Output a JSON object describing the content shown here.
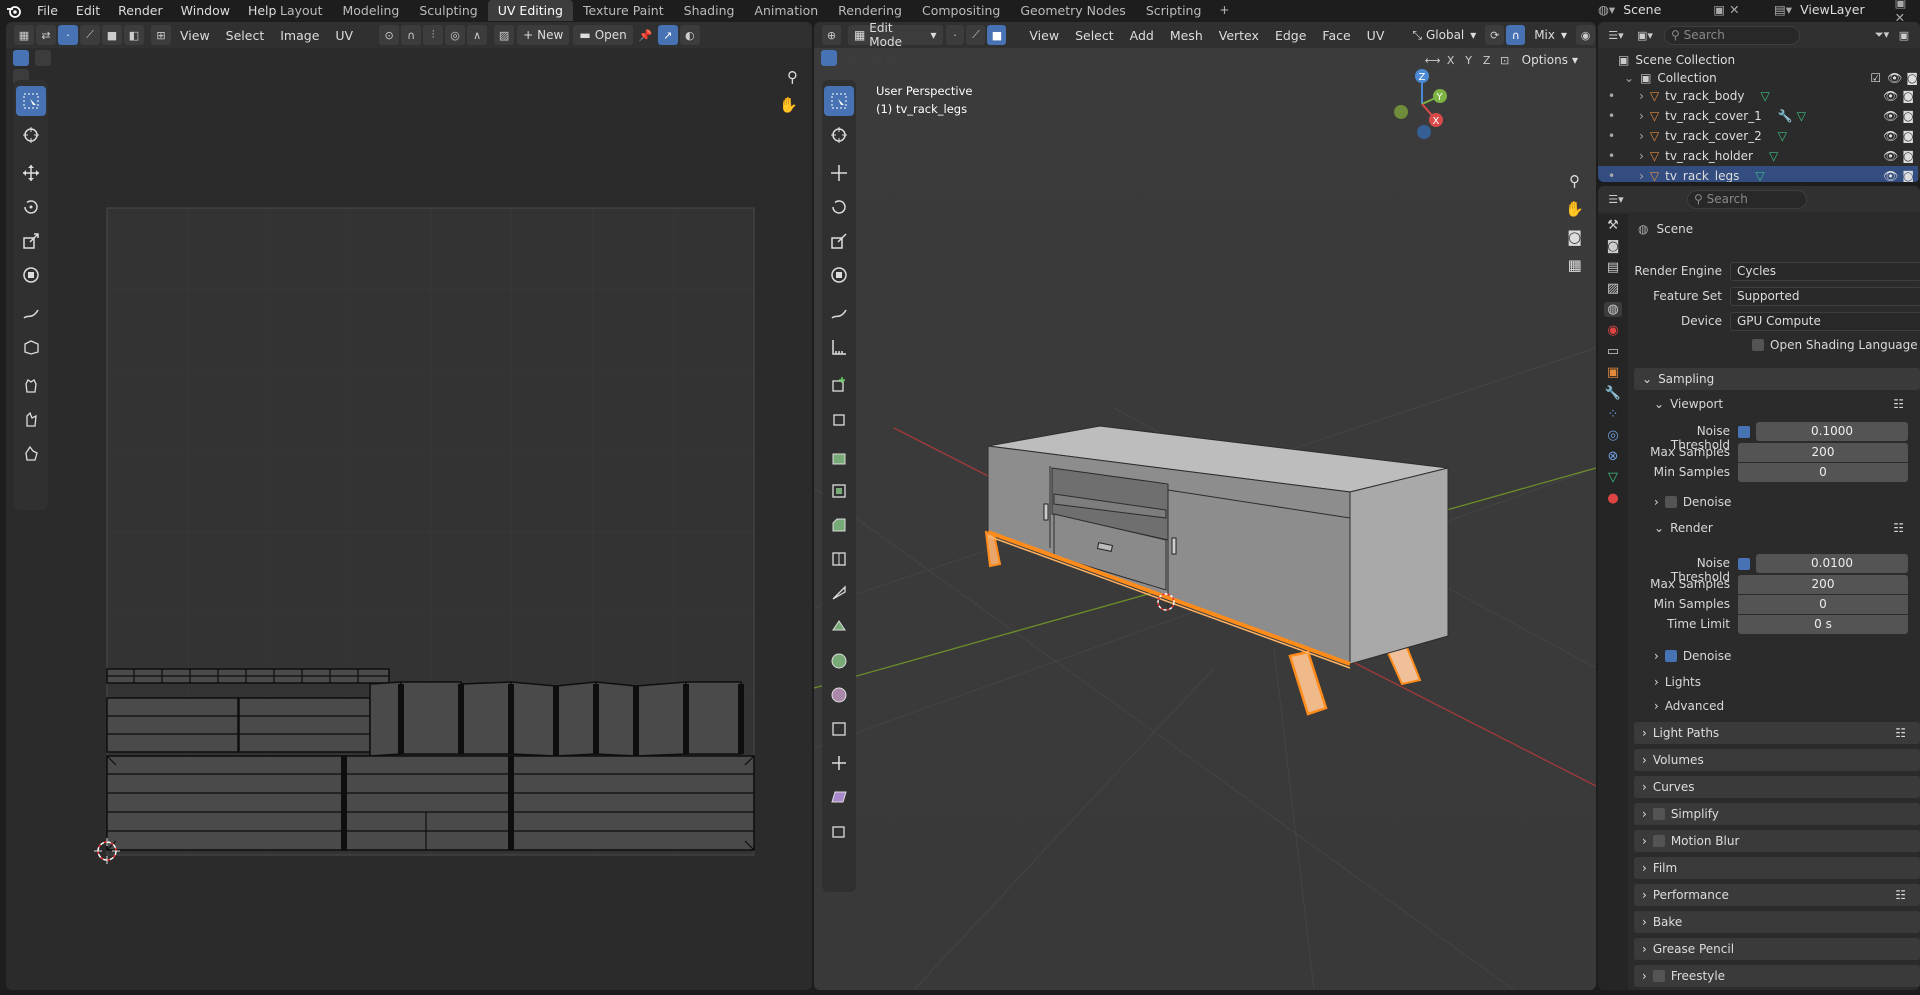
{
  "menu": [
    "File",
    "Edit",
    "Render",
    "Window",
    "Help"
  ],
  "workspaces": [
    "Layout",
    "Modeling",
    "Sculpting",
    "UV Editing",
    "Texture Paint",
    "Shading",
    "Animation",
    "Rendering",
    "Compositing",
    "Geometry Nodes",
    "Scripting"
  ],
  "active_workspace": "UV Editing",
  "scene_name": "Scene",
  "view_layer": "ViewLayer",
  "uv_editor": {
    "menus": [
      "View",
      "Select",
      "Image",
      "UV"
    ],
    "new_label": "New",
    "open_label": "Open"
  },
  "viewport": {
    "mode": "Edit Mode",
    "menus": [
      "View",
      "Select",
      "Add",
      "Mesh",
      "Vertex",
      "Edge",
      "Face",
      "UV"
    ],
    "orientation": "Global",
    "shading": "Mix",
    "options_label": "Options",
    "axes": [
      "X",
      "Y",
      "Z"
    ],
    "overlay_title": "User Perspective",
    "overlay_object": "(1) tv_rack_legs"
  },
  "outliner": {
    "search_placeholder": "Search",
    "scene_collection": "Scene Collection",
    "collection": "Collection",
    "objects": [
      "tv_rack_body",
      "tv_rack_cover_1",
      "tv_rack_cover_2",
      "tv_rack_holder",
      "tv_rack_legs"
    ]
  },
  "properties": {
    "search_placeholder": "Search",
    "context": "Scene",
    "render_engine_label": "Render Engine",
    "render_engine": "Cycles",
    "feature_set_label": "Feature Set",
    "feature_set": "Supported",
    "device_label": "Device",
    "device": "GPU Compute",
    "osl_label": "Open Shading Language",
    "sampling": "Sampling",
    "viewport_label": "Viewport",
    "noise_threshold_label": "Noise Threshold",
    "viewport_noise": "0.1000",
    "max_samples_label": "Max Samples",
    "viewport_max": "200",
    "min_samples_label": "Min Samples",
    "viewport_min": "0",
    "denoise_label": "Denoise",
    "render_label": "Render",
    "render_noise": "0.0100",
    "render_max": "200",
    "render_min": "0",
    "time_limit_label": "Time Limit",
    "time_limit": "0 s",
    "lights": "Lights",
    "advanced": "Advanced",
    "panels": [
      "Light Paths",
      "Volumes",
      "Curves",
      "Simplify",
      "Motion Blur",
      "Film",
      "Performance",
      "Bake",
      "Grease Pencil",
      "Freestyle"
    ]
  },
  "colors": {
    "accent": "#4772b3",
    "selection": "#ff8c1a",
    "bg": "#1d1d1d",
    "panel": "#303030"
  }
}
